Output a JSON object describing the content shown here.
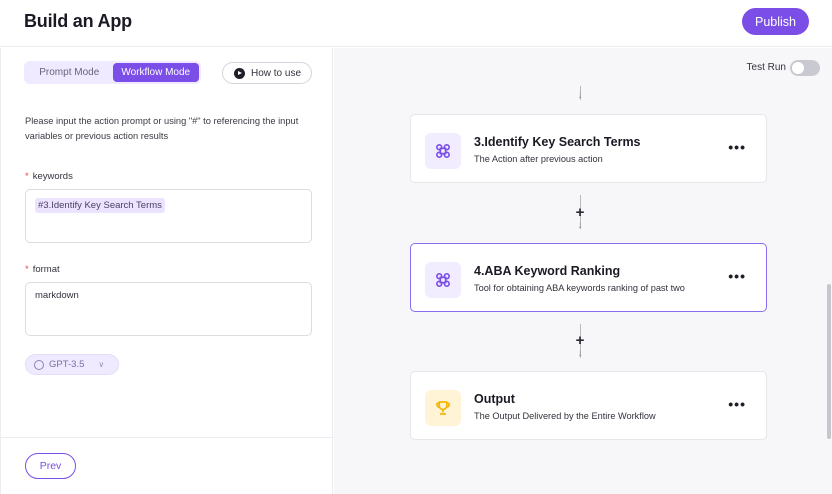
{
  "header": {
    "title": "Build an App",
    "publish_label": "Publish"
  },
  "left_panel": {
    "modes": [
      {
        "label": "Prompt Mode",
        "active": false
      },
      {
        "label": "Workflow Mode",
        "active": true
      }
    ],
    "how_to_use_label": "How to use",
    "instruction": "Please input the action prompt or using \"#\" to referencing the input variables or previous action results",
    "fields": [
      {
        "label": "keywords",
        "required": true,
        "value": "#3.Identify Key Search Terms",
        "is_reference": true
      },
      {
        "label": "format",
        "required": true,
        "value": "markdown",
        "is_reference": false
      }
    ],
    "model": {
      "label": "GPT-3.5",
      "icon": "openai-icon"
    },
    "prev_label": "Prev"
  },
  "right_panel": {
    "test_run_label": "Test Run",
    "test_run_enabled": false,
    "steps": [
      {
        "title": "3.Identify Key Search Terms",
        "description": "The Action after previous action",
        "icon": "command-icon",
        "selected": false
      },
      {
        "title": "4.ABA Keyword Ranking",
        "description": "Tool for obtaining ABA keywords ranking of past two",
        "icon": "command-icon",
        "selected": true
      },
      {
        "title": "Output",
        "description": "The Output Delivered by the Entire Workflow",
        "icon": "trophy-icon",
        "selected": false
      }
    ]
  },
  "colors": {
    "accent": "#7b4ee8",
    "required": "#e5484d",
    "output_icon": "#f5b400"
  }
}
